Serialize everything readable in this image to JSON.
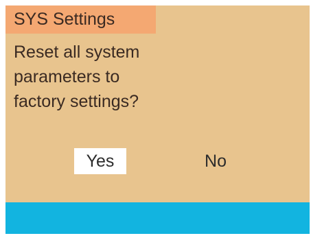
{
  "dialog": {
    "title": "SYS Settings",
    "message_lines": [
      "Reset all system",
      "parameters to",
      "factory settings?"
    ],
    "yes_label": "Yes",
    "no_label": "No",
    "selected_option": "Yes"
  },
  "colors": {
    "background": "#e8c48e",
    "title_bar": "#f4a872",
    "footer_bar": "#12b4e0",
    "selected_button": "#ffffff",
    "text": "#3a2a22"
  }
}
